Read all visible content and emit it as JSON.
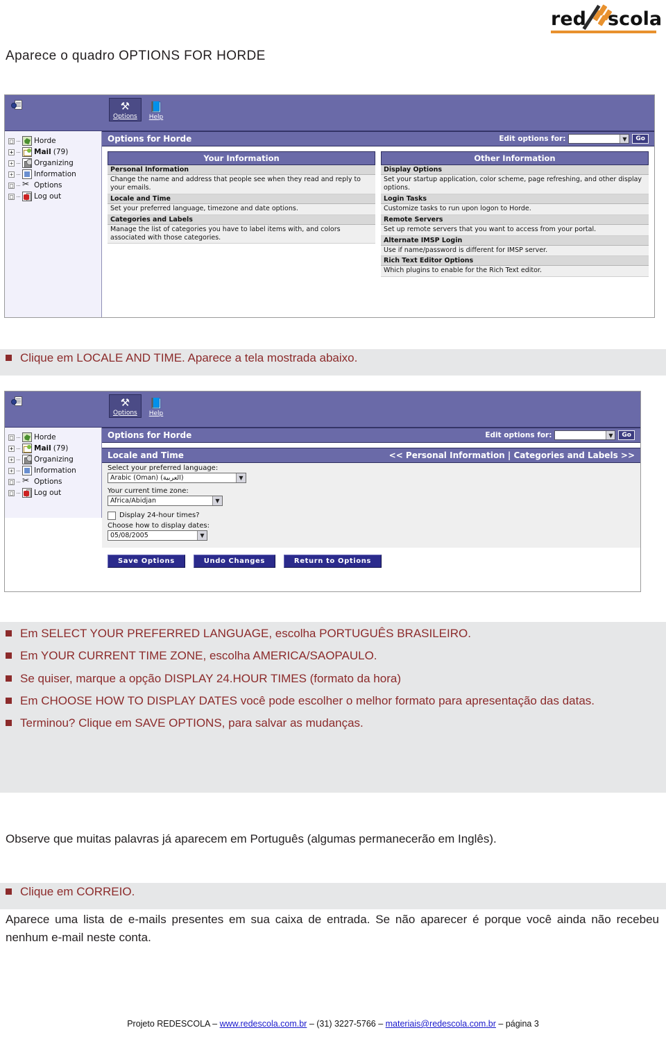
{
  "logo": {
    "part1": "red",
    "part2": "scola",
    "alt": "Redescola logo"
  },
  "headline": "Aparece o quadro OPTIONS FOR HORDE",
  "screenshot1": {
    "toolbar": [
      {
        "icon": "options-icon",
        "glyph": "⚒",
        "label": "Options",
        "selected": true
      },
      {
        "icon": "help-icon",
        "glyph": "📘",
        "label": "Help",
        "selected": false
      }
    ],
    "sidebar": [
      {
        "node": "□",
        "icon": "horde-icon",
        "label": "Horde",
        "count": "",
        "bold": false
      },
      {
        "node": "+",
        "icon": "mail-icon",
        "label": "Mail",
        "count": "(79)",
        "bold": true
      },
      {
        "node": "+",
        "icon": "organizing-icon",
        "label": "Organizing",
        "count": "",
        "bold": false
      },
      {
        "node": "+",
        "icon": "information-icon",
        "label": "Information",
        "count": "",
        "bold": false
      },
      {
        "node": "□",
        "icon": "options-icon",
        "label": "Options",
        "count": "",
        "bold": false
      },
      {
        "node": "□",
        "icon": "logout-icon",
        "label": "Log out",
        "count": "",
        "bold": false
      }
    ],
    "page_title": "Options for Horde",
    "edit_options_label": "Edit options for:",
    "edit_options_value": "",
    "go_label": "Go",
    "left_column": {
      "heading": "Your Information",
      "items": [
        {
          "title": "Personal Information",
          "desc": "Change the name and address that people see when they read and reply to your emails."
        },
        {
          "title": "Locale and Time",
          "desc": "Set your preferred language, timezone and date options."
        },
        {
          "title": "Categories and Labels",
          "desc": "Manage the list of categories you have to label items with, and colors associated with those categories."
        }
      ]
    },
    "right_column": {
      "heading": "Other Information",
      "items": [
        {
          "title": "Display Options",
          "desc": "Set your startup application, color scheme, page refreshing, and other display options."
        },
        {
          "title": "Login Tasks",
          "desc": "Customize tasks to run upon logon to Horde."
        },
        {
          "title": "Remote Servers",
          "desc": "Set up remote servers that you want to access from your portal."
        },
        {
          "title": "Alternate IMSP Login",
          "desc": "Use if name/password is different for IMSP server."
        },
        {
          "title": "Rich Text Editor Options",
          "desc": "Which plugins to enable for the Rich Text editor."
        }
      ]
    }
  },
  "instruction1": "Clique em LOCALE AND TIME. Aparece a tela mostrada abaixo.",
  "screenshot2": {
    "toolbar": [
      {
        "icon": "options-icon",
        "glyph": "⚒",
        "label": "Options",
        "selected": true
      },
      {
        "icon": "help-icon",
        "glyph": "📘",
        "label": "Help",
        "selected": false
      }
    ],
    "sidebar": [
      {
        "node": "□",
        "icon": "horde-icon",
        "label": "Horde",
        "count": "",
        "bold": false
      },
      {
        "node": "+",
        "icon": "mail-icon",
        "label": "Mail",
        "count": "(79)",
        "bold": true
      },
      {
        "node": "+",
        "icon": "organizing-icon",
        "label": "Organizing",
        "count": "",
        "bold": false
      },
      {
        "node": "+",
        "icon": "information-icon",
        "label": "Information",
        "count": "",
        "bold": false
      },
      {
        "node": "□",
        "icon": "options-icon",
        "label": "Options",
        "count": "",
        "bold": false
      },
      {
        "node": "□",
        "icon": "logout-icon",
        "label": "Log out",
        "count": "",
        "bold": false
      }
    ],
    "page_title": "Options for Horde",
    "edit_options_label": "Edit options for:",
    "edit_options_value": "",
    "go_label": "Go",
    "section_title": "Locale and Time",
    "nav_links": "<< Personal Information | Categories and Labels >>",
    "fields": {
      "language_label": "Select your preferred language:",
      "language_value": "Arabic (Oman) (العربية)",
      "timezone_label": "Your current time zone:",
      "timezone_value": "Africa/Abidjan",
      "twentyfour_label": "Display 24-hour times?",
      "twentyfour_checked": false,
      "dateformat_label": "Choose how to display dates:",
      "dateformat_value": "05/08/2005"
    },
    "buttons": [
      {
        "label": "Save Options"
      },
      {
        "label": "Undo Changes"
      },
      {
        "label": "Return to Options"
      }
    ]
  },
  "instructions2": [
    "Em SELECT YOUR PREFERRED LANGUAGE, escolha PORTUGUÊS BRASILEIRO.",
    "Em YOUR CURRENT TIME ZONE, escolha AMERICA/SAOPAULO.",
    "Se quiser, marque a opção DISPLAY 24.HOUR TIMES (formato da hora)",
    "Em CHOOSE HOW TO DISPLAY DATES você pode escolher o melhor formato para apresentação das datas.",
    "Terminou? Clique em SAVE OPTIONS, para salvar as mudanças."
  ],
  "note": "Observe que muitas palavras já aparecem em Português (algumas permanecerão em Inglês).",
  "instruction3": "Clique em CORREIO.",
  "closing": "Aparece uma lista de e-mails presentes em sua caixa de entrada. Se não aparecer é porque você ainda não recebeu nenhum e-mail neste conta.",
  "footer": {
    "prefix": "Projeto REDESCOLA – ",
    "site": "www.redescola.com.br",
    "mid": " – (31) 3227-5766 – ",
    "email": "materiais@redescola.com.br",
    "suffix": " – página 3"
  },
  "colors": {
    "horde_purple": "#6a6aa8",
    "horde_navy": "#2b2b8c",
    "accent_orange": "#e8912e",
    "text_red": "#8c2b2b",
    "band_gray": "#e6e7e8",
    "link_blue": "#1a1acc"
  }
}
